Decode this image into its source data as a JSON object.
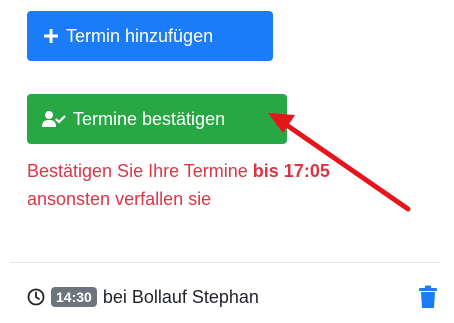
{
  "buttons": {
    "add_label": "Termin hinzufügen",
    "confirm_label": "Termine bestätigen"
  },
  "warning": {
    "part1": "Bestätigen Sie Ihre Termine ",
    "bold": "bis 17:05",
    "part2": "ansonsten verfallen sie"
  },
  "appointment": {
    "time": "14:30",
    "text": "bei Bollauf Stephan"
  },
  "colors": {
    "primary": "#1a7cf6",
    "success": "#28a745",
    "danger": "#dc3545",
    "badge": "#6c757d",
    "annotation_arrow": "#e8141c"
  }
}
